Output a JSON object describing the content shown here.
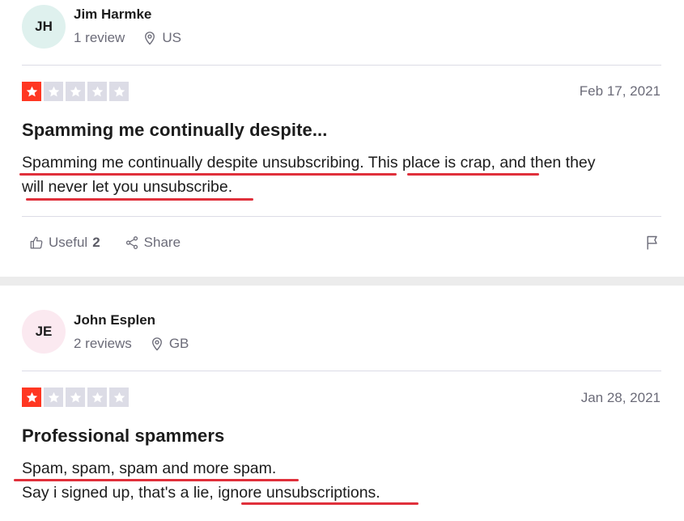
{
  "reviews": [
    {
      "avatar_initials": "JH",
      "avatar_color": "#dff1ee",
      "name": "Jim Harmke",
      "review_count": "1 review",
      "country": "US",
      "rating": 1,
      "date": "Feb 17, 2021",
      "title": "Spamming me continually despite...",
      "body_lines": [
        "Spamming me continually despite unsubscribing. This place is crap, and then they",
        "will never let you unsubscribe."
      ],
      "underlined_phrases": [
        "Spamming me continually despite unsubscribing",
        "This place is crap",
        "will never let you unsubscribe"
      ],
      "useful_label": "Useful",
      "useful_count": "2",
      "share_label": "Share"
    },
    {
      "avatar_initials": "JE",
      "avatar_color": "#fbe9f0",
      "name": "John Esplen",
      "review_count": "2 reviews",
      "country": "GB",
      "rating": 1,
      "date": "Jan 28, 2021",
      "title": "Professional spammers",
      "body_lines": [
        "Spam, spam, spam and more spam.",
        "Say i signed up, that's a lie, ignore unsubscriptions."
      ],
      "underlined_phrases": [
        "Spam, spam, spam and more spam",
        "ignore unsubscriptions"
      ]
    }
  ],
  "colors": {
    "star_active": "#ff3722",
    "star_inactive": "#dcdce6",
    "underline": "#e0303b",
    "meta_text": "#6b6b78"
  }
}
